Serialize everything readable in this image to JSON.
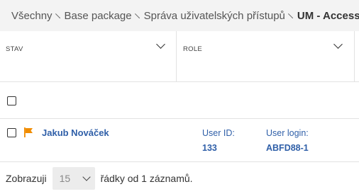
{
  "breadcrumb": {
    "items": [
      "Všechny",
      "Base package",
      "Správa uživatelských přístupů"
    ],
    "current": "UM - Access r"
  },
  "table": {
    "columns": [
      {
        "label": "STAV"
      },
      {
        "label": "ROLE"
      }
    ],
    "rows": [
      {
        "name": "Jakub Nováček",
        "flag_color": "#f08c00",
        "user_id_label": "User ID:",
        "user_id": "133",
        "user_login_label": "User login:",
        "user_login": "ABFD88-1"
      }
    ]
  },
  "footer": {
    "prefix": "Zobrazuji",
    "page_size": "15",
    "suffix": "řádky od 1 záznamů."
  },
  "colors": {
    "link": "#2f5fa8",
    "flag": "#f08c00",
    "breadcrumb_bg": "#f3f3f3"
  }
}
